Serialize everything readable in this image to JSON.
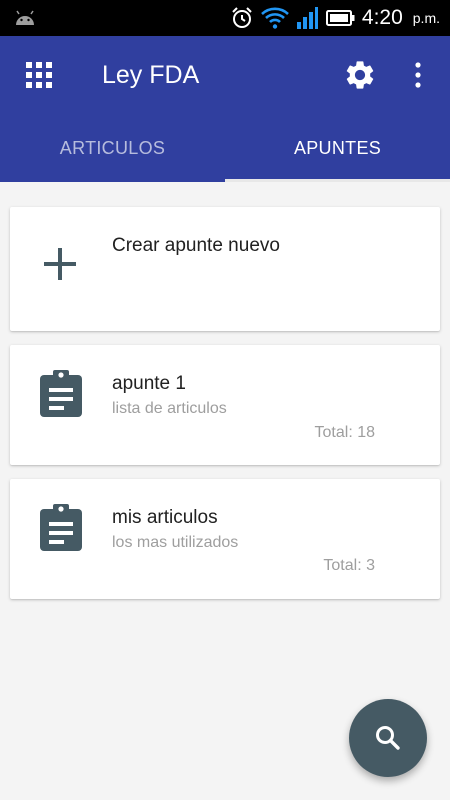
{
  "status_bar": {
    "time": "4:20",
    "ampm": "p.m."
  },
  "app_bar": {
    "title": "Ley FDA"
  },
  "tabs": [
    {
      "label": "ARTICULOS",
      "active": false
    },
    {
      "label": "APUNTES",
      "active": true
    }
  ],
  "create_card": {
    "label": "Crear apunte nuevo"
  },
  "notes": [
    {
      "title": "apunte 1",
      "subtitle": "lista de articulos",
      "total": "Total: 18"
    },
    {
      "title": "mis articulos",
      "subtitle": "los mas utilizados",
      "total": "Total: 3"
    }
  ],
  "colors": {
    "primary": "#303f9f",
    "fab": "#455a64",
    "icon": "#455a64",
    "background": "#f4f4f4"
  },
  "icons": [
    "android-icon",
    "alarm-icon",
    "wifi-icon",
    "signal-icon",
    "battery-icon",
    "apps-grid-icon",
    "gear-icon",
    "more-vert-icon",
    "plus-icon",
    "clipboard-icon",
    "search-icon"
  ]
}
